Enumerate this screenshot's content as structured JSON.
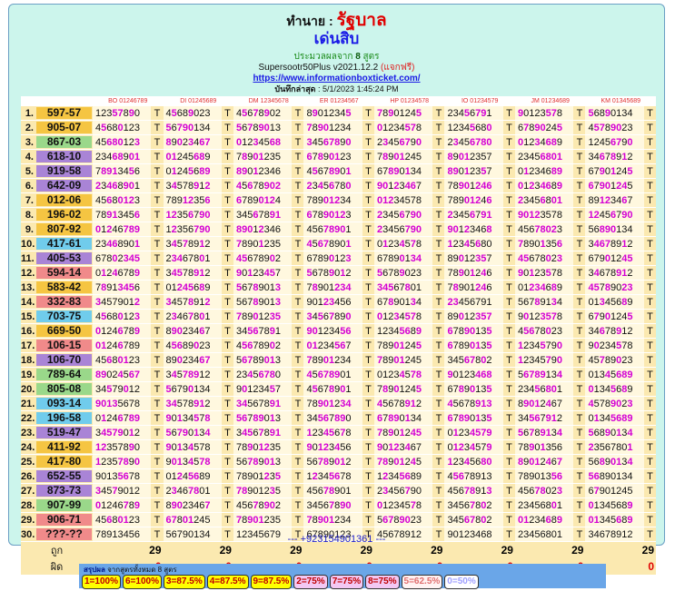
{
  "header": {
    "prefix": "ทำนาย : ",
    "title": "รัฐบาล",
    "subtitle": "เด่นสิบ",
    "info_prefix": "ประมวลผลจาก ",
    "info_count": "8",
    "info_suffix": " สูตร",
    "version": "Supersootr50Plus v2021.12.2 ",
    "version_free": "(แจกฟรี)",
    "url": "https://www.informationboxticket.com/",
    "saved_label": "บันทึกล่าสุด",
    "saved_value": " : 5/1/2023 1:45:24 PM"
  },
  "column_headers": [
    "BO 01246789",
    "DI 01245689",
    "DM 12345678",
    "ER 01234567",
    "HP 01234578",
    "IO 01234579",
    "JM 01234689",
    "KM 01345689"
  ],
  "colors": {
    "tag_yellow": "#f5c542",
    "tag_pink": "#f08a8a",
    "tag_cyan": "#70ccec",
    "tag_purple": "#a984d6",
    "tag_green": "#9ad88a",
    "highlight_digit": "#d400d4",
    "red": "#e00000"
  },
  "rows": [
    {
      "n": "1.",
      "tag": "597-57",
      "color": "#f5c542",
      "cells": [
        "12357890",
        "45689023",
        "45678902",
        "89012345",
        "78901245",
        "23456791",
        "90123578",
        "56890134"
      ]
    },
    {
      "n": "2.",
      "tag": "905-07",
      "color": "#f5c542",
      "cells": [
        "45680123",
        "56790134",
        "56789013",
        "78901234",
        "01234578",
        "12345680",
        "67890245",
        "45789023"
      ]
    },
    {
      "n": "3.",
      "tag": "867-03",
      "color": "#9ad88a",
      "cells": [
        "45680123",
        "89023467",
        "01234568",
        "34567890",
        "23456790",
        "23456780",
        "01234689",
        "12456790"
      ]
    },
    {
      "n": "4.",
      "tag": "618-10",
      "color": "#a984d6",
      "cells": [
        "23468901",
        "01245689",
        "78901235",
        "67890123",
        "78901245",
        "89012357",
        "23456801",
        "34678912"
      ]
    },
    {
      "n": "5.",
      "tag": "919-58",
      "color": "#a984d6",
      "cells": [
        "78913456",
        "01245689",
        "89012346",
        "45678901",
        "67890134",
        "89012357",
        "01234689",
        "67901245"
      ]
    },
    {
      "n": "6.",
      "tag": "642-09",
      "color": "#a984d6",
      "cells": [
        "23468901",
        "34578912",
        "45678902",
        "23456780",
        "90123467",
        "78901246",
        "01234689",
        "67901245"
      ]
    },
    {
      "n": "7.",
      "tag": "012-06",
      "color": "#f5c542",
      "cells": [
        "45680123",
        "78912356",
        "67890124",
        "78901234",
        "01234578",
        "78901246",
        "23456801",
        "89123467"
      ]
    },
    {
      "n": "8.",
      "tag": "196-02",
      "color": "#f5c542",
      "cells": [
        "78913456",
        "12356790",
        "34567891",
        "67890123",
        "23456790",
        "23456791",
        "90123578",
        "12456790"
      ]
    },
    {
      "n": "9.",
      "tag": "807-92",
      "color": "#f5c542",
      "cells": [
        "01246789",
        "12356790",
        "89012346",
        "45678901",
        "23456790",
        "90123468",
        "45678023",
        "56890134"
      ]
    },
    {
      "n": "10.",
      "tag": "417-61",
      "color": "#70ccec",
      "cells": [
        "23468901",
        "34578912",
        "78901235",
        "45678901",
        "01234578",
        "12345680",
        "78901356",
        "34678912"
      ]
    },
    {
      "n": "11.",
      "tag": "405-53",
      "color": "#a984d6",
      "cells": [
        "67802345",
        "23467801",
        "45678902",
        "67890123",
        "67890134",
        "89012357",
        "45678023",
        "67901245"
      ]
    },
    {
      "n": "12.",
      "tag": "594-14",
      "color": "#f08a8a",
      "cells": [
        "01246789",
        "34578912",
        "90123457",
        "56789012",
        "56789023",
        "78901246",
        "90123578",
        "34678912"
      ]
    },
    {
      "n": "13.",
      "tag": "583-42",
      "color": "#f5c542",
      "cells": [
        "78913456",
        "01245689",
        "56789013",
        "78901234",
        "34567801",
        "78901246",
        "01234689",
        "45789023"
      ]
    },
    {
      "n": "14.",
      "tag": "332-83",
      "color": "#f08a8a",
      "cells": [
        "34579012",
        "34578912",
        "56789013",
        "90123456",
        "67890134",
        "23456791",
        "56789134",
        "01345689"
      ]
    },
    {
      "n": "15.",
      "tag": "703-75",
      "color": "#70ccec",
      "cells": [
        "45680123",
        "23467801",
        "78901235",
        "34567890",
        "01234578",
        "89012357",
        "90123578",
        "67901245"
      ]
    },
    {
      "n": "16.",
      "tag": "669-50",
      "color": "#f5c542",
      "cells": [
        "01246789",
        "89023467",
        "34567891",
        "90123456",
        "12345689",
        "67890135",
        "45678023",
        "34678912"
      ]
    },
    {
      "n": "17.",
      "tag": "106-15",
      "color": "#f08a8a",
      "cells": [
        "01246789",
        "45689023",
        "45678902",
        "01234567",
        "78901245",
        "67890135",
        "12345790",
        "90234578"
      ]
    },
    {
      "n": "18.",
      "tag": "106-70",
      "color": "#a984d6",
      "cells": [
        "45680123",
        "89023467",
        "56789013",
        "78901234",
        "78901245",
        "34567802",
        "12345790",
        "45789023"
      ]
    },
    {
      "n": "19.",
      "tag": "789-64",
      "color": "#9ad88a",
      "cells": [
        "89024567",
        "34578912",
        "23456780",
        "45678901",
        "01234578",
        "90123468",
        "56789134",
        "01345689"
      ]
    },
    {
      "n": "20.",
      "tag": "805-08",
      "color": "#9ad88a",
      "cells": [
        "34579012",
        "56790134",
        "90123457",
        "45678901",
        "78901245",
        "67890135",
        "23456801",
        "01345689"
      ]
    },
    {
      "n": "21.",
      "tag": "093-14",
      "color": "#70ccec",
      "cells": [
        "90135678",
        "34578912",
        "34567891",
        "78901234",
        "45678912",
        "45678913",
        "89012467",
        "45789023"
      ]
    },
    {
      "n": "22.",
      "tag": "196-58",
      "color": "#70ccec",
      "cells": [
        "01246789",
        "90134578",
        "56789013",
        "34567890",
        "67890134",
        "67890135",
        "34567912",
        "01345689"
      ]
    },
    {
      "n": "23.",
      "tag": "519-47",
      "color": "#a984d6",
      "cells": [
        "34579012",
        "56790134",
        "34567891",
        "12345678",
        "78901245",
        "01234579",
        "56789134",
        "56890134"
      ]
    },
    {
      "n": "24.",
      "tag": "411-92",
      "color": "#f5c542",
      "cells": [
        "12357890",
        "90134578",
        "78901235",
        "90123456",
        "90123467",
        "01234579",
        "78901356",
        "23567801"
      ]
    },
    {
      "n": "25.",
      "tag": "417-80",
      "color": "#f5c542",
      "cells": [
        "12357890",
        "90134578",
        "56789013",
        "56789012",
        "78901245",
        "12345680",
        "89012467",
        "56890134"
      ]
    },
    {
      "n": "26.",
      "tag": "652-55",
      "color": "#a984d6",
      "cells": [
        "90135678",
        "01245689",
        "78901235",
        "12345678",
        "12345689",
        "45678913",
        "78901356",
        "56890134"
      ]
    },
    {
      "n": "27.",
      "tag": "873-73",
      "color": "#a984d6",
      "cells": [
        "34579012",
        "23467801",
        "78901235",
        "45678901",
        "23456790",
        "45678913",
        "45678023",
        "67901245"
      ]
    },
    {
      "n": "28.",
      "tag": "907-99",
      "color": "#9ad88a",
      "cells": [
        "01246789",
        "89023467",
        "45678902",
        "34567890",
        "01234578",
        "34567802",
        "23456801",
        "01345689"
      ]
    },
    {
      "n": "29.",
      "tag": "906-71",
      "color": "#f08a8a",
      "cells": [
        "45680123",
        "67801245",
        "78901235",
        "78901234",
        "56789023",
        "34567802",
        "01234689",
        "01345689"
      ]
    },
    {
      "n": "30.",
      "tag": "???-??",
      "color": "#f08a8a",
      "cells": [
        "78913456",
        "56790134",
        "12345679",
        "67890123",
        "45678912",
        "90123468",
        "23456801",
        "34678912"
      ]
    }
  ],
  "summary_rows": {
    "correct_label": "ถูก",
    "wrong_label": "ผิด",
    "correct": [
      "29",
      "29",
      "29",
      "29",
      "29",
      "29",
      "29",
      "29"
    ],
    "wrong": [
      "0",
      "0",
      "0",
      "0",
      "0",
      "0",
      "0",
      "0"
    ]
  },
  "footer_link": "--- +923154901361 ---",
  "summary": {
    "title": "สรุปผล",
    "subtitle": " จากสูตรทั้งหมด 8 สูตร",
    "badges": [
      {
        "label": "1=100%",
        "bg": "#ffff00",
        "fg": "#c00000"
      },
      {
        "label": "6=100%",
        "bg": "#ffff00",
        "fg": "#c00000"
      },
      {
        "label": "3=87.5%",
        "bg": "#ffff00",
        "fg": "#c00000"
      },
      {
        "label": "4=87.5%",
        "bg": "#ffff00",
        "fg": "#c00000"
      },
      {
        "label": "9=87.5%",
        "bg": "#ffff00",
        "fg": "#c00000"
      },
      {
        "label": "2=75%",
        "bg": "#f3c8f3",
        "fg": "#c00000"
      },
      {
        "label": "7=75%",
        "bg": "#f3c8f3",
        "fg": "#c00000"
      },
      {
        "label": "8=75%",
        "bg": "#f3c8f3",
        "fg": "#c00000"
      },
      {
        "label": "5=62.5%",
        "bg": "#fff3f3",
        "fg": "#e07070"
      },
      {
        "label": "0=50%",
        "bg": "#ffffff",
        "fg": "#a0a0ff"
      }
    ]
  }
}
